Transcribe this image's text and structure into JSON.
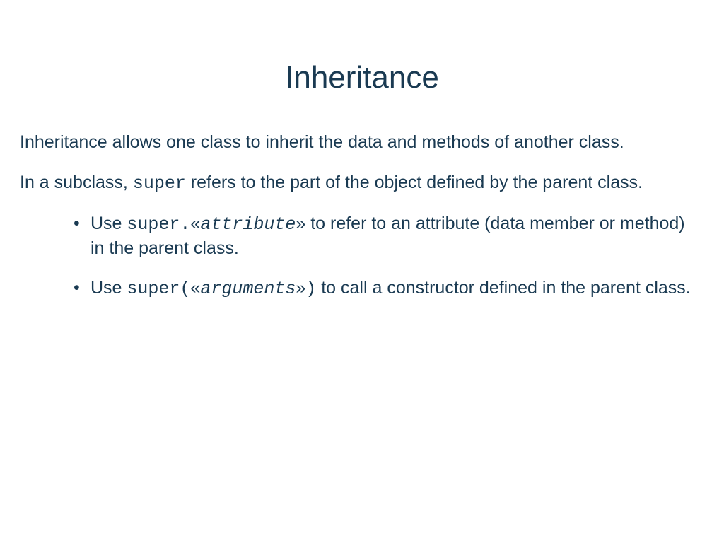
{
  "slide": {
    "title": "Inheritance",
    "para1": "Inheritance allows one class to inherit the data and methods of another class.",
    "para2_pre": "In a subclass, ",
    "para2_code": "super",
    "para2_post": " refers to the part of the object defined by the parent class.",
    "bullet1_pre": "Use ",
    "bullet1_code1": "super.",
    "bullet1_guillemet_open": "«",
    "bullet1_attr": "attribute",
    "bullet1_guillemet_close": "»",
    "bullet1_post": " to refer to an attribute (data member or method) in the parent class.",
    "bullet2_pre": "Use ",
    "bullet2_code1": "super(",
    "bullet2_guillemet_open": "«",
    "bullet2_args": "arguments",
    "bullet2_guillemet_close": "»",
    "bullet2_code2": ")",
    "bullet2_post": " to call a constructor defined in the parent class."
  }
}
